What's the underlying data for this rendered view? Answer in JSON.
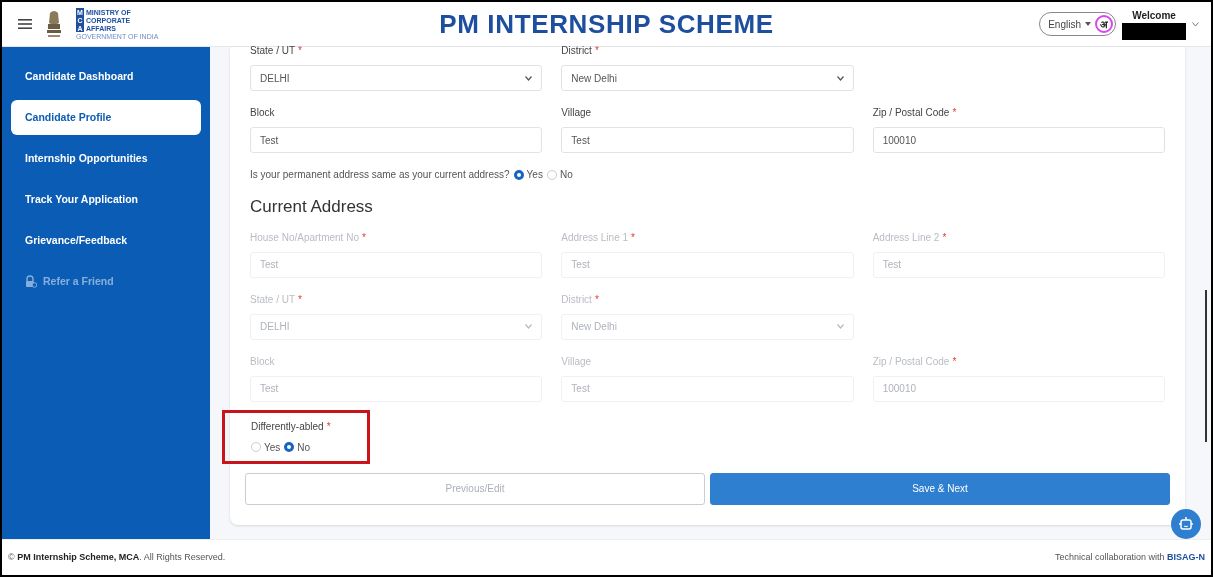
{
  "header": {
    "logo": {
      "lines": [
        "MINISTRY OF",
        "CORPORATE",
        "AFFAIRS"
      ],
      "initials": [
        "M",
        "C",
        "A"
      ],
      "subtitle": "GOVERNMENT OF INDIA"
    },
    "title": "PM INTERNSHIP SCHEME",
    "language": {
      "label": "English",
      "badge": "अ"
    },
    "welcome": "Welcome",
    "user_name_redacted": true
  },
  "sidebar": {
    "items": [
      {
        "label": "Candidate Dashboard",
        "kind": "plain",
        "selected": false,
        "disabled": false
      },
      {
        "label": "Candidate Profile",
        "kind": "plain",
        "selected": true,
        "disabled": false
      },
      {
        "label": "Internship Opportunities",
        "kind": "plain",
        "selected": false,
        "disabled": false
      },
      {
        "label": "Track Your Application",
        "kind": "plain",
        "selected": false,
        "disabled": false
      },
      {
        "label": "Grievance/Feedback",
        "kind": "plain",
        "selected": false,
        "disabled": false
      },
      {
        "label": "Refer a Friend",
        "kind": "with-icon",
        "selected": false,
        "disabled": true
      }
    ]
  },
  "permanent_address": {
    "rows": [
      [
        {
          "label": "State / UT",
          "mark": "*",
          "value": "DELHI",
          "kind": "select",
          "disabled": false
        },
        {
          "label": "District",
          "mark": "*",
          "value": "New Delhi",
          "kind": "select",
          "disabled": false
        }
      ],
      [
        {
          "label": "Block",
          "value": "Test",
          "kind": "text",
          "disabled": false
        },
        {
          "label": "Village",
          "value": "Test",
          "kind": "text",
          "disabled": false
        },
        {
          "label": "Zip / Postal Code",
          "mark": "*",
          "value": "100010",
          "kind": "text",
          "disabled": false
        }
      ]
    ]
  },
  "address_question": {
    "text": "Is your permanent address same as your current address?",
    "options": [
      {
        "label": "Yes",
        "selected": true
      },
      {
        "label": "No",
        "selected": false
      }
    ]
  },
  "current_address": {
    "heading": "Current Address",
    "rows": [
      [
        {
          "label": "House No/Apartment No",
          "mark": "*",
          "value": "Test",
          "kind": "text",
          "disabled": true
        },
        {
          "label": "Address Line 1",
          "mark": "*",
          "value": "Test",
          "kind": "text",
          "disabled": true
        },
        {
          "label": "Address Line 2",
          "mark": "*",
          "value": "Test",
          "kind": "text",
          "disabled": true
        }
      ],
      [
        {
          "label": "State / UT",
          "mark": "*",
          "value": "DELHI",
          "kind": "select",
          "disabled": true
        },
        {
          "label": "District",
          "mark": "*",
          "value": "New Delhi",
          "kind": "select",
          "disabled": true
        }
      ],
      [
        {
          "label": "Block",
          "value": "Test",
          "kind": "text",
          "disabled": true
        },
        {
          "label": "Village",
          "value": "Test",
          "kind": "text",
          "disabled": true
        },
        {
          "label": "Zip / Postal Code",
          "mark": "*",
          "value": "100010",
          "kind": "text",
          "disabled": true
        }
      ]
    ]
  },
  "differently_abled": {
    "label": "Differently-abled",
    "mark": "*",
    "highlighted": true,
    "options": [
      {
        "label": "Yes",
        "selected": false
      },
      {
        "label": "No",
        "selected": true
      }
    ]
  },
  "buttons": [
    {
      "label": "Previous/Edit",
      "kind": "secondary"
    },
    {
      "label": "Save & Next",
      "kind": "primary"
    }
  ],
  "footer": {
    "left": "© **PM Internship Scheme, MCA**. All Rights Reserved.",
    "right": "Technical collaboration with **BISAG-N**"
  }
}
